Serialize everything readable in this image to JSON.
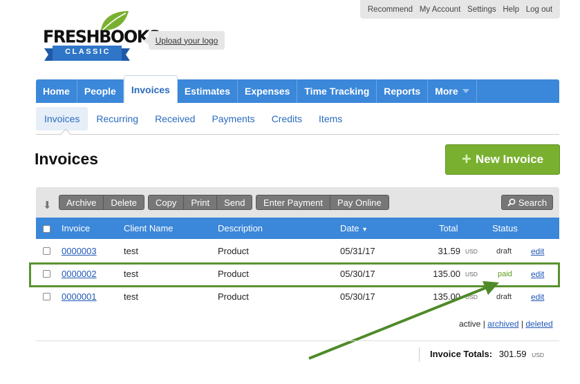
{
  "util_bar": [
    "Recommend",
    "My Account",
    "Settings",
    "Help",
    "Log out"
  ],
  "logo": {
    "word": "FRESHBOOKS",
    "badge": "CLASSIC"
  },
  "upload_logo": "Upload your logo",
  "main_nav": [
    {
      "label": "Home"
    },
    {
      "label": "People"
    },
    {
      "label": "Invoices",
      "active": true
    },
    {
      "label": "Estimates"
    },
    {
      "label": "Expenses"
    },
    {
      "label": "Time Tracking"
    },
    {
      "label": "Reports"
    },
    {
      "label": "More"
    }
  ],
  "sub_nav": [
    {
      "label": "Invoices",
      "active": true
    },
    {
      "label": "Recurring"
    },
    {
      "label": "Received"
    },
    {
      "label": "Payments"
    },
    {
      "label": "Credits"
    },
    {
      "label": "Items"
    }
  ],
  "page_title": "Invoices",
  "new_invoice_button": {
    "plus": "+",
    "label": "New Invoice"
  },
  "toolbar": {
    "group1": [
      "Archive",
      "Delete"
    ],
    "group2": [
      "Copy",
      "Print",
      "Send"
    ],
    "group3": [
      "Enter Payment",
      "Pay Online"
    ],
    "search": "Search"
  },
  "table": {
    "headers": {
      "invoice": "Invoice",
      "client": "Client Name",
      "description": "Description",
      "date": "Date",
      "date_sort": "▼",
      "total": "Total",
      "status": "Status"
    },
    "rows": [
      {
        "invoice": "0000003",
        "client": "test",
        "description": "Product",
        "date": "05/31/17",
        "total": "31.59",
        "currency": "USD",
        "status": "draft",
        "action": "edit"
      },
      {
        "invoice": "0000002",
        "client": "test",
        "description": "Product",
        "date": "05/30/17",
        "total": "135.00",
        "currency": "USD",
        "status": "paid",
        "action": "edit"
      },
      {
        "invoice": "0000001",
        "client": "test",
        "description": "Product",
        "date": "05/30/17",
        "total": "135.00",
        "currency": "USD",
        "status": "draft",
        "action": "edit"
      }
    ]
  },
  "filters": {
    "active": "active",
    "sep": "|",
    "archived": "archived",
    "deleted": "deleted"
  },
  "totals": {
    "label": "Invoice Totals:",
    "value": "301.59",
    "currency": "USD"
  },
  "colors": {
    "nav_blue": "#3b87d9",
    "new_invoice_green": "#7ab030",
    "highlight_green": "#5a9130",
    "link_blue": "#1f57b7"
  }
}
